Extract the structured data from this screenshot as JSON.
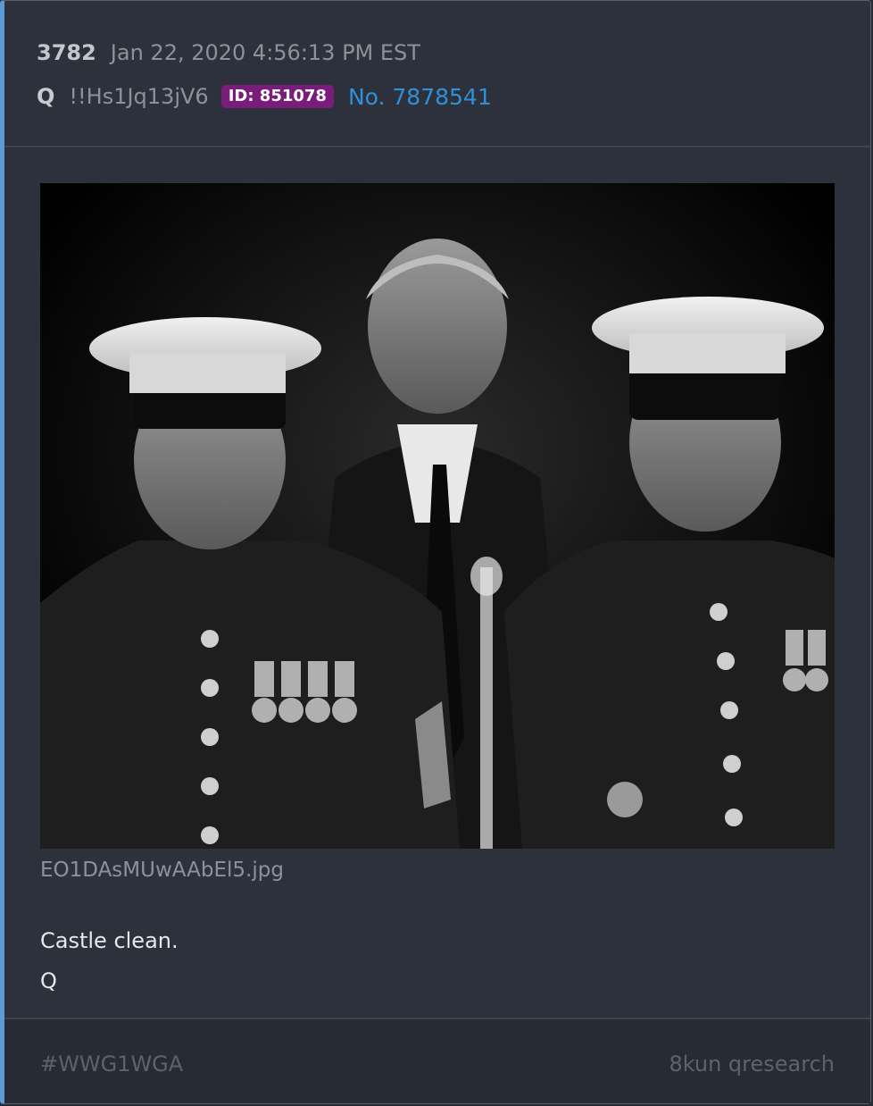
{
  "post": {
    "number": "3782",
    "timestamp": "Jan 22, 2020 4:56:13 PM EST",
    "author": "Q",
    "tripcode": "!!Hs1Jq13jV6",
    "id_badge": "ID: 851078",
    "post_link": "No. 7878541"
  },
  "attachment": {
    "filename": "EO1DAsMUwAAbEl5.jpg"
  },
  "message": {
    "line1": "Castle clean.",
    "line2": "Q"
  },
  "footer": {
    "hashtag": "#WWG1WGA",
    "source": "8kun qresearch"
  },
  "colors": {
    "accent_bar": "#5b9bd5",
    "id_badge": "#7a1c7a",
    "link": "#2f8fd8"
  }
}
